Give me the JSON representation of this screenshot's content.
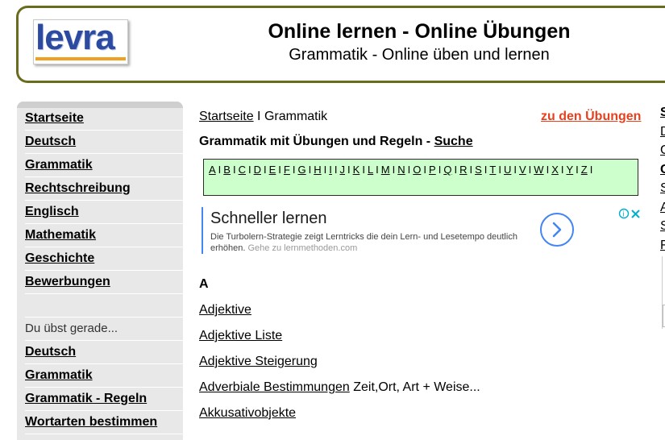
{
  "header": {
    "logo_text": "levra",
    "title": "Online lernen - Online Übungen",
    "subtitle": "Grammatik - Online üben und lernen"
  },
  "sidebar": {
    "items": [
      "Startseite",
      "Deutsch",
      "Grammatik",
      "Rechtschreibung",
      "Englisch",
      "Mathematik",
      "Geschichte",
      "Bewerbungen"
    ],
    "current_label": "Du übst gerade...",
    "current_items": [
      "Deutsch",
      "Grammatik",
      "Grammatik - Regeln",
      "Wortarten bestimmen"
    ]
  },
  "breadcrumb": {
    "home": "Startseite",
    "separator": "I",
    "current": "Grammatik"
  },
  "exercises_link": "zu den Übungen",
  "heading": {
    "text": "Grammatik mit Übungen und Regeln - ",
    "link": "Suche"
  },
  "alphabet": [
    "A",
    "B",
    "C",
    "D",
    "E",
    "F",
    "G",
    "H",
    "I",
    "J",
    "K",
    "L",
    "M",
    "N",
    "O",
    "P",
    "Q",
    "R",
    "S",
    "T",
    "U",
    "V",
    "W",
    "X",
    "Y",
    "Z"
  ],
  "ad": {
    "title": "Schneller lernen",
    "description": "Die Turbolern-Strategie zeigt Lerntricks die dein Lern- und Lesetempo deutlich erhöhen.",
    "url_text": "Gehe zu lernmethoden.com",
    "icon": "chevron-right-icon"
  },
  "section_letter": "A",
  "entries": [
    {
      "link": "Adjektive",
      "note": ""
    },
    {
      "link": "Adjektive Liste",
      "note": ""
    },
    {
      "link": "Adjektive Steigerung",
      "note": ""
    },
    {
      "link": "Adverbiale Bestimmungen",
      "note": " Zeit,Ort, Art + Weise..."
    },
    {
      "link": "Akkusativobjekte",
      "note": ""
    }
  ],
  "right_column": [
    "S",
    "D",
    "G",
    "G",
    "S",
    "A",
    "S",
    "F"
  ],
  "colors": {
    "accent_orange": "#e8401e",
    "alpha_bg": "#ccffcc",
    "header_border": "#6b6b1f",
    "logo_blue": "#2b4aa0"
  }
}
